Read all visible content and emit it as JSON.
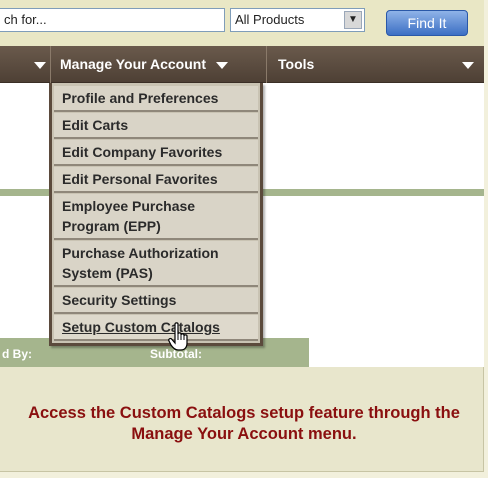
{
  "search": {
    "value": "ch for...",
    "category": "All Products",
    "button": "Find It"
  },
  "nav": {
    "account_label": "Manage Your Account",
    "tools_label": "Tools"
  },
  "menu": {
    "items": [
      "Profile and Preferences",
      "Edit Carts",
      "Edit Company Favorites",
      "Edit Personal Favorites",
      "Employee Purchase Program (EPP)",
      "Purchase Authorization System (PAS)",
      "Security Settings",
      "Setup Custom Catalogs"
    ]
  },
  "table": {
    "col1": "d By:",
    "col2": "Subtotal:"
  },
  "caption": "Access the Custom Catalogs setup feature through the Manage Your Account menu.",
  "colors": {
    "nav_bg": "#5a4a3e",
    "caption": "#8a0f0f",
    "find_button": "#3c6fc4",
    "accent_green": "#a5b58d"
  }
}
